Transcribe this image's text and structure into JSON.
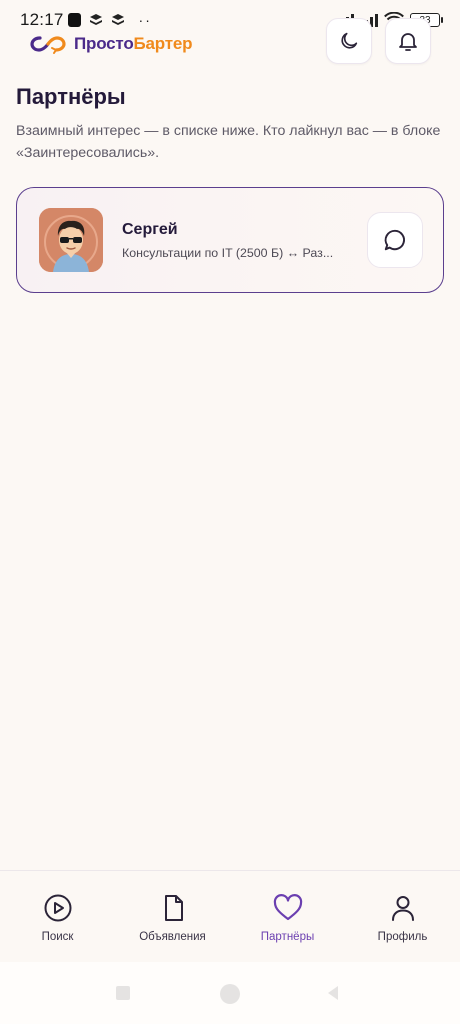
{
  "status_bar": {
    "time": "12:17",
    "battery": "33"
  },
  "header": {
    "logo_part1": "Просто",
    "logo_part2": "Бартер",
    "brand_colors": {
      "primary": "#4b2a8a",
      "accent": "#f08a1c"
    }
  },
  "page": {
    "title": "Партнёры",
    "subtitle": "Взаимный интерес — в списке ниже. Кто лайкнул вас — в блоке «Заинтересовались»."
  },
  "partners": [
    {
      "name": "Сергей",
      "description": "Консультации по IT (2500 Б) ↔ Раз...",
      "avatar_icon": "avatar-with-sunglasses"
    }
  ],
  "bottom_nav": {
    "items": [
      {
        "label": "Поиск",
        "icon": "play-circle-icon",
        "active": false
      },
      {
        "label": "Объявления",
        "icon": "document-icon",
        "active": false
      },
      {
        "label": "Партнёры",
        "icon": "heart-icon",
        "active": true
      },
      {
        "label": "Профиль",
        "icon": "person-icon",
        "active": false
      }
    ],
    "active_color": "#6b3fb0"
  }
}
